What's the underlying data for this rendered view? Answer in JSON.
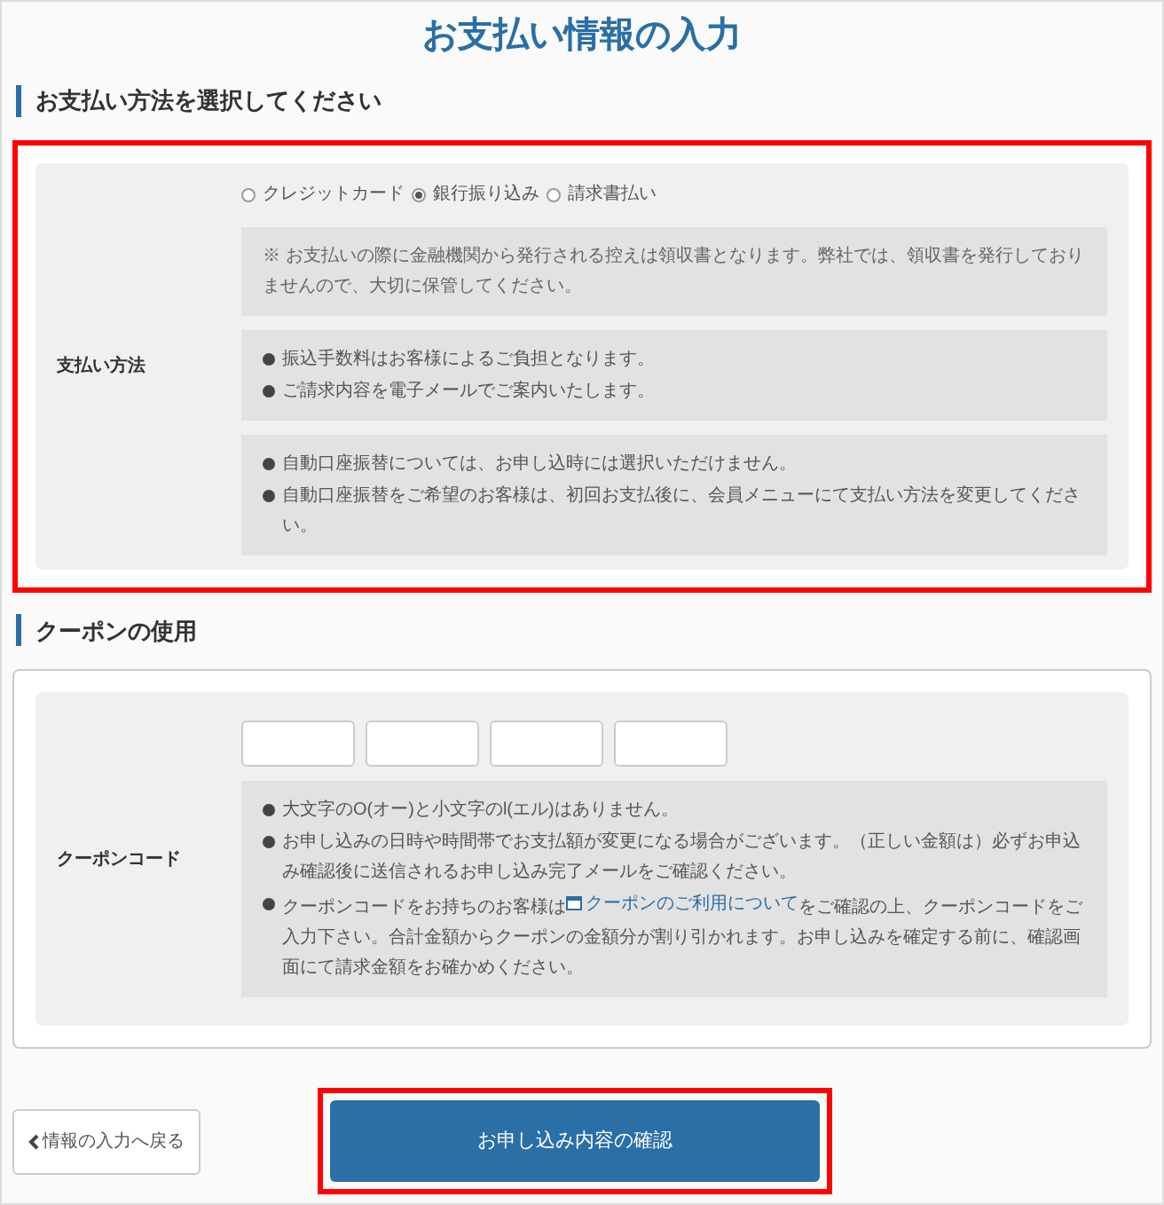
{
  "page_title": "お支払い情報の入力",
  "payment": {
    "heading": "お支払い方法を選択してください",
    "highlighted": true,
    "label": "支払い方法",
    "options": [
      {
        "label": "クレジットカード",
        "selected": false
      },
      {
        "label": "銀行振り込み",
        "selected": true
      },
      {
        "label": "請求書払い",
        "selected": false
      }
    ],
    "note": "※ お支払いの際に金融機関から発行される控えは領収書となります。弊社では、領収書を発行しておりませんので、大切に保管してください。",
    "info_boxes": [
      [
        "振込手数料はお客様によるご負担となります。",
        "ご請求内容を電子メールでご案内いたします。"
      ],
      [
        "自動口座振替については、お申し込時には選択いただけません。",
        "自動口座振替をご希望のお客様は、初回お支払後に、会員メニューにて支払い方法を変更してください。"
      ]
    ]
  },
  "coupon": {
    "heading": "クーポンの使用",
    "label": "クーポンコード",
    "notes": [
      {
        "kind": "text",
        "text": "大文字のO(オー)と小文字のl(エル)はありません。"
      },
      {
        "kind": "text",
        "text": "お申し込みの日時や時間帯でお支払額が変更になる場合がございます。（正しい金額は）必ずお申込み確認後に送信されるお申し込み完了メールをご確認ください。"
      },
      {
        "kind": "link",
        "before": "クーポンコードをお持ちのお客様は",
        "link": "クーポンのご利用について",
        "after": "をご確認の上、クーポンコードをご入力下さい。合計金額からクーポンの金額分が割り引かれます。お申し込みを確定する前に、確認画面にて請求金額をお確かめください。"
      }
    ]
  },
  "buttons": {
    "back": "情報の入力へ戻る",
    "confirm": "お申し込み内容の確認",
    "confirm_highlighted": true
  }
}
